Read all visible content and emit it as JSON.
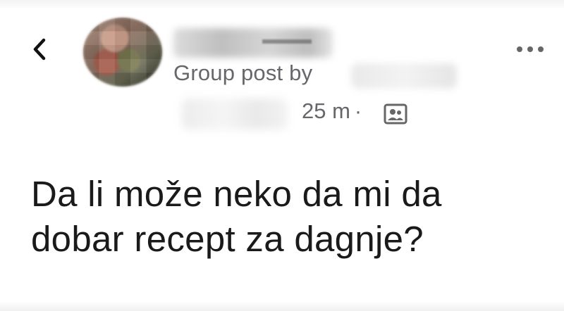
{
  "header": {
    "group_post_label": "Group post by",
    "timestamp": "25 m",
    "separator": "·",
    "back_icon": "chevron-left-icon",
    "more_icon": "more-horizontal-icon",
    "audience_icon": "group-members-icon"
  },
  "post": {
    "lines": [
      "Da li može neko da mi da",
      "dobar recept za dagnje?"
    ]
  }
}
